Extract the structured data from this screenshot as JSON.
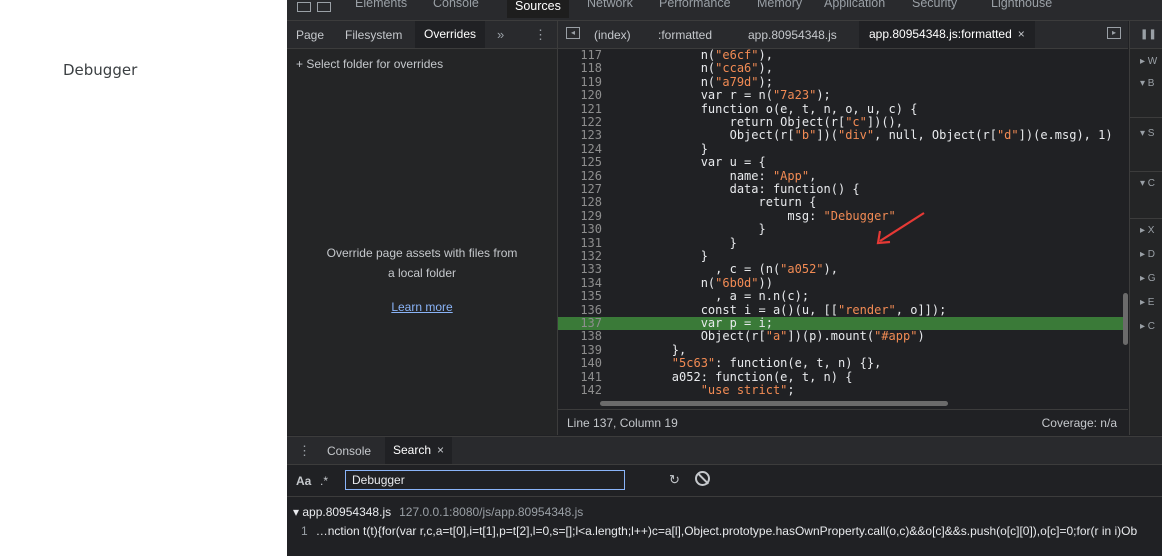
{
  "page": {
    "label": "Debugger"
  },
  "devtools": {
    "main_tabs": [
      "Elements",
      "Console",
      "Sources",
      "Network",
      "Performance",
      "Memory",
      "Application",
      "Security",
      "Lighthouse"
    ],
    "active_main_tab": "Sources",
    "navigator": {
      "tabs": [
        "Page",
        "Filesystem",
        "Overrides"
      ],
      "active_tab": "Overrides",
      "more": "»",
      "select_folder": "+ Select folder for overrides",
      "empty_line1": "Override page assets with files from",
      "empty_line2": "a local folder",
      "learn_more": "Learn more"
    },
    "editor": {
      "tabs": [
        "(index)",
        ":formatted",
        "app.80954348.js",
        "app.80954348.js:formatted"
      ],
      "active_tab": "app.80954348.js:formatted",
      "close": "×",
      "highlighted_line": 137,
      "lines": [
        {
          "n": "117",
          "t": "            n(\"e6cf\"),"
        },
        {
          "n": "118",
          "t": "            n(\"cca6\"),"
        },
        {
          "n": "119",
          "t": "            n(\"a79d\");"
        },
        {
          "n": "120",
          "t": "            var r = n(\"7a23\");"
        },
        {
          "n": "121",
          "t": "            function o(e, t, n, o, u, c) {"
        },
        {
          "n": "122",
          "t": "                return Object(r[\"c\"])(),"
        },
        {
          "n": "123",
          "t": "                Object(r[\"b\"])(\"div\", null, Object(r[\"d\"])(e.msg), 1)"
        },
        {
          "n": "124",
          "t": "            }"
        },
        {
          "n": "125",
          "t": "            var u = {"
        },
        {
          "n": "126",
          "t": "                name: \"App\","
        },
        {
          "n": "127",
          "t": "                data: function() {"
        },
        {
          "n": "128",
          "t": "                    return {"
        },
        {
          "n": "129",
          "t": "                        msg: \"Debugger\""
        },
        {
          "n": "130",
          "t": "                    }"
        },
        {
          "n": "131",
          "t": "                }"
        },
        {
          "n": "132",
          "t": "            }"
        },
        {
          "n": "133",
          "t": "              , c = (n(\"a052\"),"
        },
        {
          "n": "134",
          "t": "            n(\"6b0d\"))"
        },
        {
          "n": "135",
          "t": "              , a = n.n(c);"
        },
        {
          "n": "136",
          "t": "            const i = a()(u, [[\"render\", o]]);"
        },
        {
          "n": "137",
          "t": "            var p = i;"
        },
        {
          "n": "138",
          "t": "            Object(r[\"a\"])(p).mount(\"#app\")"
        },
        {
          "n": "139",
          "t": "        },"
        },
        {
          "n": "140",
          "t": "        \"5c63\": function(e, t, n) {},"
        },
        {
          "n": "141",
          "t": "        a052: function(e, t, n) {"
        },
        {
          "n": "142",
          "t": "            \"use strict\";"
        }
      ],
      "status_position": "Line 137, Column 19",
      "coverage": "Coverage: n/a"
    },
    "side_items": [
      "▸ W",
      "▾ B",
      "▾ S",
      "▾ C",
      "▸ X",
      "▸ D",
      "▸ G",
      "▸ E",
      "▸ C"
    ],
    "drawer": {
      "tabs": [
        "Console",
        "Search"
      ],
      "active_tab": "Search",
      "close": "×",
      "case_option": "Aa",
      "regex_option": ".*",
      "search_value": "Debugger",
      "result_file": "▾ app.80954348.js",
      "result_path": "127.0.0.1:8080/js/app.80954348.js",
      "result_line_no": "1",
      "result_text": "…nction t(t){for(var r,c,a=t[0],i=t[1],p=t[2],l=0,s=[];l<a.length;l++)c=a[l],Object.prototype.hasOwnProperty.call(o,c)&&o[c]&&s.push(o[c][0]),o[c]=0;for(r in i)Ob"
    }
  }
}
